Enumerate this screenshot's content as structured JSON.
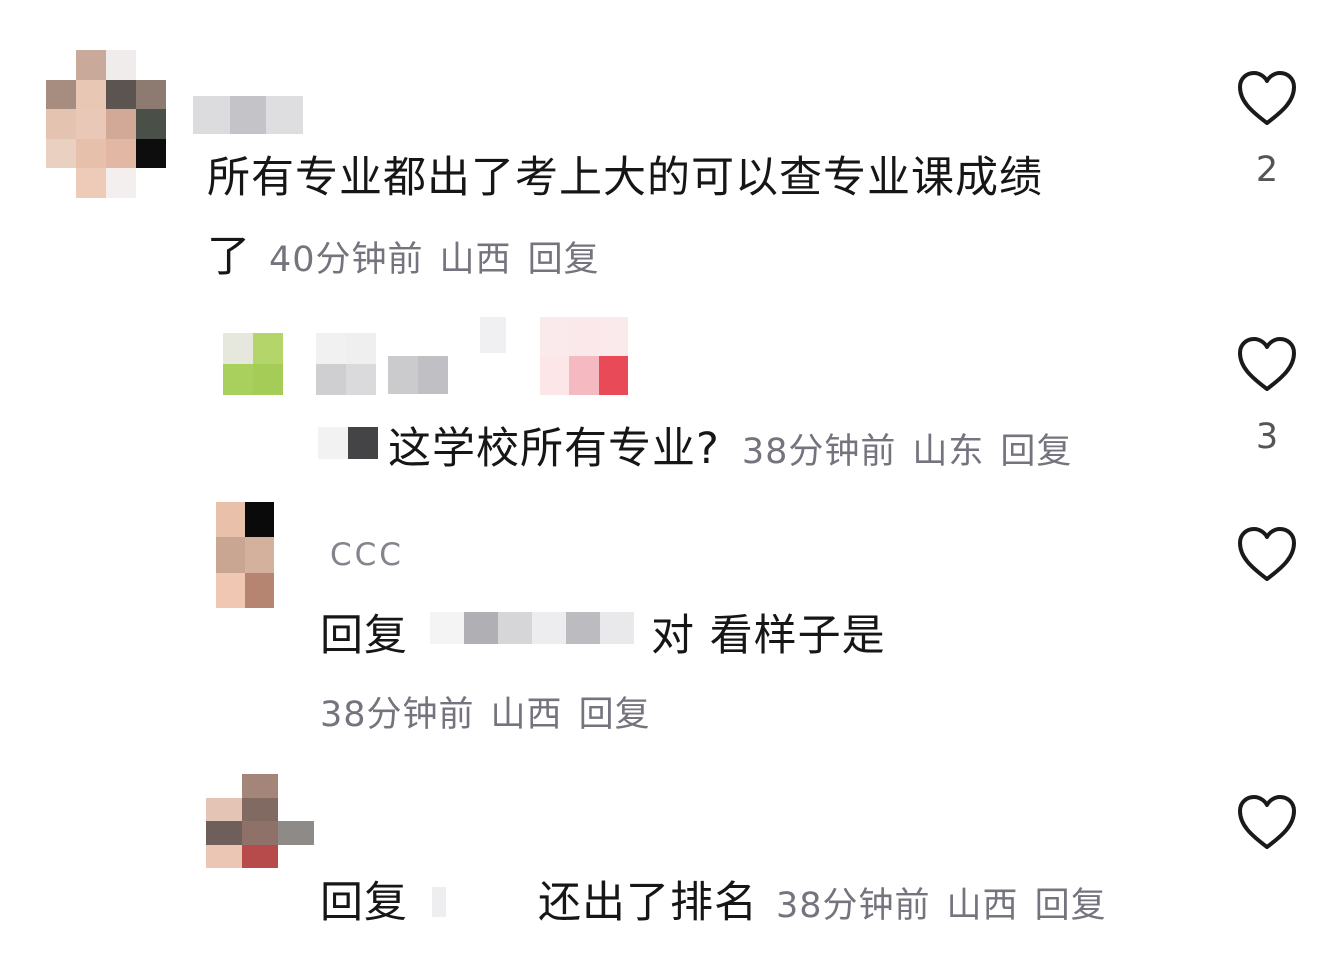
{
  "comments": [
    {
      "text_line1": "所有专业都出了考上大的可以查专业课成绩",
      "text_line2": "了",
      "time": "40分钟前",
      "location": "山西",
      "reply_label": "回复",
      "likes": "2"
    },
    {
      "text": "这学校所有专业?",
      "time": "38分钟前",
      "location": "山东",
      "reply_label": "回复",
      "likes": "3"
    },
    {
      "username": "CCC",
      "reply_prefix": "回复",
      "text": "对 看样子是",
      "time": "38分钟前",
      "location": "山西",
      "reply_label": "回复"
    },
    {
      "reply_prefix": "回复",
      "text": "还出了排名",
      "time": "38分钟前",
      "location": "山西",
      "reply_label": "回复"
    }
  ],
  "icons": {
    "like": "heart-outline-icon"
  },
  "colors": {
    "body_text": "#161616",
    "meta_text": "#75737d",
    "heart_stroke": "#1a1a1a"
  }
}
